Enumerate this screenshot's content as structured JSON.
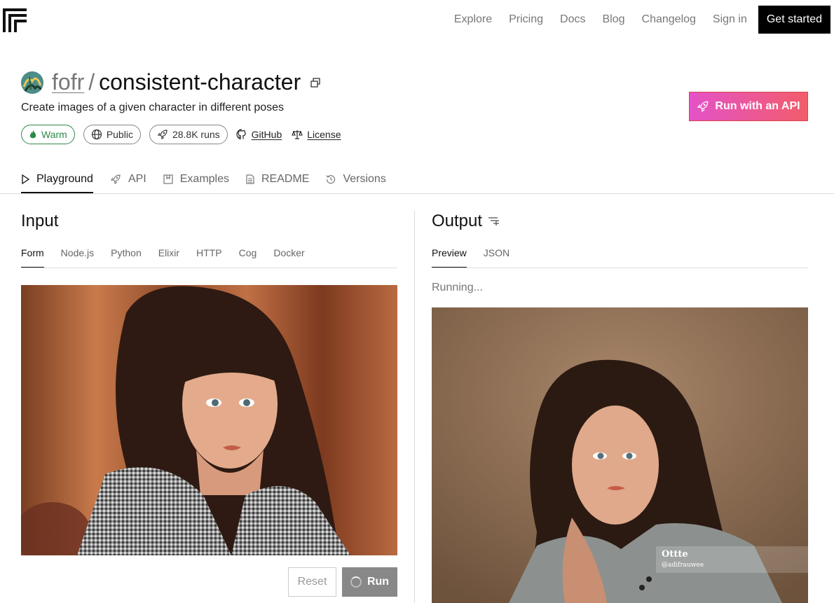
{
  "nav": {
    "items": [
      "Explore",
      "Pricing",
      "Docs",
      "Blog",
      "Changelog",
      "Sign in"
    ],
    "cta": "Get started"
  },
  "model": {
    "owner": "fofr",
    "separator": "/",
    "name": "consistent-character",
    "description": "Create images of a given character in different poses",
    "status": "Warm",
    "visibility": "Public",
    "runs": "28.8K runs",
    "github": "GitHub",
    "license": "License"
  },
  "api_button": "Run with an API",
  "tabs": [
    "Playground",
    "API",
    "Examples",
    "README",
    "Versions"
  ],
  "input": {
    "title": "Input",
    "subtabs": [
      "Form",
      "Node.js",
      "Python",
      "Elixir",
      "HTTP",
      "Cog",
      "Docker"
    ],
    "reset": "Reset",
    "run": "Run"
  },
  "output": {
    "title": "Output",
    "subtabs": [
      "Preview",
      "JSON"
    ],
    "status": "Running...",
    "watermark_line1": "Ottte",
    "watermark_line2": "@adifrauwee"
  },
  "colors": {
    "warm": "#2f8a4a",
    "api_gradient_start": "#e452c8",
    "api_gradient_end": "#f25d6a",
    "cta_bg": "#000000"
  }
}
